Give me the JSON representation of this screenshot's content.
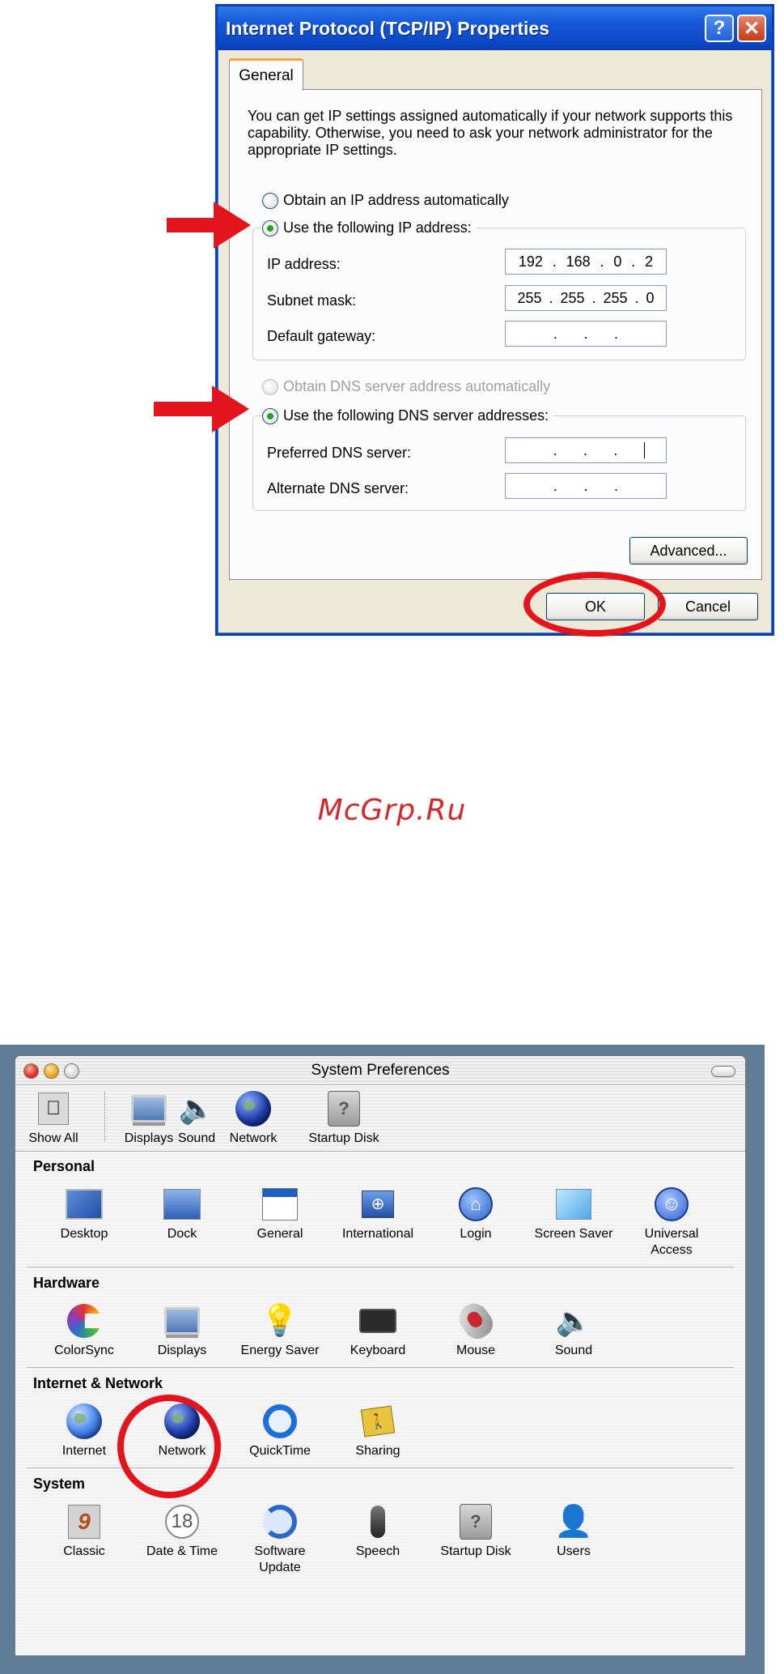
{
  "xp_dialog": {
    "title": "Internet Protocol (TCP/IP) Properties",
    "help_label": "?",
    "close_label": "✕",
    "tab_general": "General",
    "description": "You can get IP settings assigned automatically if your network supports this capability. Otherwise, you need to ask your network administrator for the appropriate IP settings.",
    "radio_obtain_ip": "Obtain an IP address automatically",
    "radio_use_ip": "Use the following IP address:",
    "ip_address_label": "IP address:",
    "ip_address_value": [
      "192",
      "168",
      "0",
      "2"
    ],
    "subnet_mask_label": "Subnet mask:",
    "subnet_mask_value": [
      "255",
      "255",
      "255",
      "0"
    ],
    "default_gateway_label": "Default gateway:",
    "dot": ".",
    "radio_obtain_dns": "Obtain DNS server address automatically",
    "radio_use_dns": "Use the following DNS server addresses:",
    "preferred_dns_label": "Preferred DNS server:",
    "alternate_dns_label": "Alternate DNS server:",
    "advanced_label": "Advanced...",
    "ok_label": "OK",
    "cancel_label": "Cancel",
    "selected_ip_mode": "use_following",
    "selected_dns_mode": "use_following"
  },
  "watermark": "McGrp.Ru",
  "mac_prefs": {
    "title": "System Preferences",
    "toolbar": [
      {
        "label": "Show All",
        "icon": "apple-box-icon"
      },
      {
        "label": "Displays",
        "icon": "monitor-icon"
      },
      {
        "label": "Sound",
        "icon": "speaker-icon"
      },
      {
        "label": "Network",
        "icon": "globe-icon"
      },
      {
        "label": "Startup Disk",
        "icon": "disk-icon"
      }
    ],
    "sections": [
      {
        "title": "Personal",
        "items": [
          "Desktop",
          "Dock",
          "General",
          "International",
          "Login",
          "Screen Saver",
          "Universal Access"
        ]
      },
      {
        "title": "Hardware",
        "items": [
          "ColorSync",
          "Displays",
          "Energy Saver",
          "Keyboard",
          "Mouse",
          "Sound"
        ]
      },
      {
        "title": "Internet & Network",
        "items": [
          "Internet",
          "Network",
          "QuickTime",
          "Sharing"
        ]
      },
      {
        "title": "System",
        "items": [
          "Classic",
          "Date & Time",
          "Software Update",
          "Speech",
          "Startup Disk",
          "Users"
        ]
      }
    ],
    "date_badge": "18"
  },
  "colors": {
    "annotation_red": "#e3141c",
    "xp_title_blue": "#0b47c4",
    "mac_frame": "#5f7d95"
  }
}
